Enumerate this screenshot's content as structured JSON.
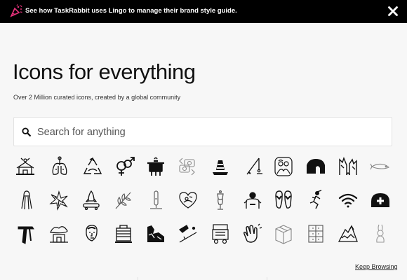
{
  "banner": {
    "text": "See how TaskRabbit uses Lingo to manage their brand style guide.",
    "icon": "party-popper-icon",
    "close_icon": "close-icon"
  },
  "hero": {
    "title": "Icons for everything",
    "subtitle": "Over 2 Million curated icons, created by a global community"
  },
  "search": {
    "placeholder": "Search for anything",
    "value": "",
    "icon": "search-icon"
  },
  "icons": {
    "row1": [
      "farm-icon",
      "lungs-icon",
      "recycle-icon",
      "gender-icon",
      "pot-icon",
      "money-exchange-icon",
      "traffic-cone-icon",
      "fishing-icon",
      "wedding-couple-icon",
      "house-icon",
      "canyon-icon",
      "fish-icon"
    ],
    "row2": [
      "octopus-icon",
      "leaf-icon",
      "rocket-launch-icon",
      "branch-icon",
      "test-tube-icon",
      "heart-icon",
      "mannequin-icon",
      "person-icon",
      "sandals-icon",
      "runner-icon",
      "wifi-icon",
      "hospital-icon"
    ],
    "row3": [
      "tools-icon",
      "hut-icon",
      "face-icon",
      "document-icon",
      "cliff-icon",
      "sports-icon",
      "food-cart-icon",
      "clapping-hands-icon",
      "box-icon",
      "cabinet-icon",
      "mountain-icon",
      "bunny-icon"
    ]
  },
  "footer": {
    "keep_browsing": "Keep Browsing"
  }
}
